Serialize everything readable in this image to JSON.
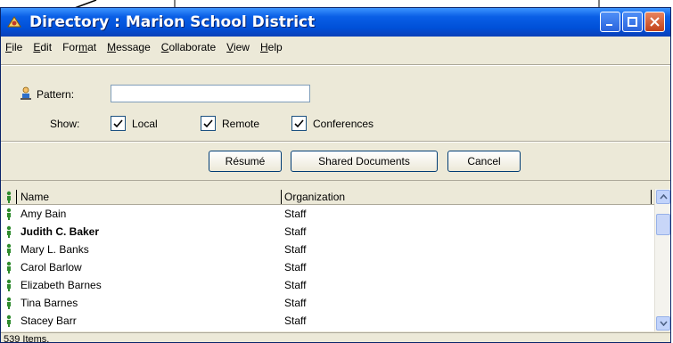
{
  "window": {
    "title": "Directory : Marion School District"
  },
  "menu": [
    {
      "pre": "",
      "u": "F",
      "post": "ile"
    },
    {
      "pre": "",
      "u": "E",
      "post": "dit"
    },
    {
      "pre": "For",
      "u": "m",
      "post": "at"
    },
    {
      "pre": "",
      "u": "M",
      "post": "essage"
    },
    {
      "pre": "",
      "u": "C",
      "post": "ollaborate"
    },
    {
      "pre": "",
      "u": "V",
      "post": "iew"
    },
    {
      "pre": "",
      "u": "H",
      "post": "elp"
    }
  ],
  "search": {
    "label": "Pattern:",
    "value": "",
    "placeholder": ""
  },
  "show": {
    "label": "Show:",
    "local": "Local",
    "remote": "Remote",
    "conferences": "Conferences"
  },
  "buttons": {
    "resume": "Résumé",
    "shared": "Shared Documents",
    "cancel": "Cancel"
  },
  "table": {
    "columns": [
      "Name",
      "Organization"
    ],
    "rows": [
      {
        "name": "Amy Bain",
        "org": "Staff"
      },
      {
        "name": "Judith C. Baker",
        "org": "Staff"
      },
      {
        "name": "Mary L. Banks",
        "org": "Staff"
      },
      {
        "name": "Carol Barlow",
        "org": "Staff"
      },
      {
        "name": "Elizabeth Barnes",
        "org": "Staff"
      },
      {
        "name": "Tina Barnes",
        "org": "Staff"
      },
      {
        "name": "Stacey Barr",
        "org": "Staff"
      }
    ]
  },
  "status": {
    "text": "539 Items."
  },
  "colors": {
    "titlebar": "#0a5fe6",
    "window_bg": "#ece9d8",
    "person_icon": "#2e8b2e"
  }
}
